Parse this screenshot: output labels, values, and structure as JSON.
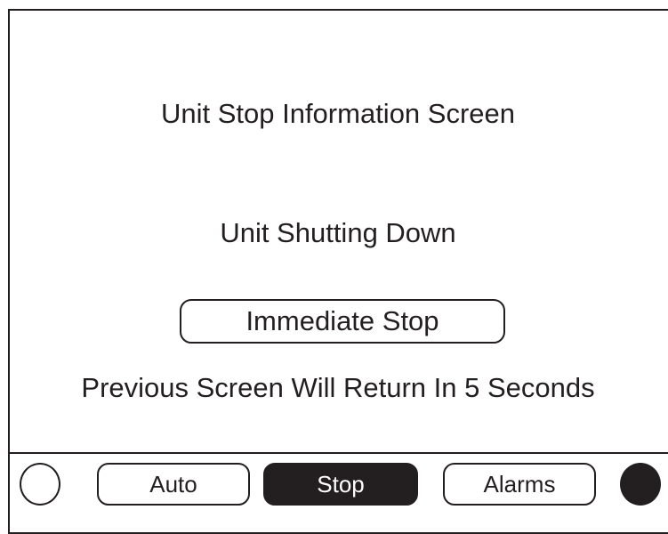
{
  "screen": {
    "title": "Unit Stop Information Screen",
    "status": "Unit Shutting Down",
    "action_button_label": "Immediate Stop",
    "return_message": "Previous Screen Will Return In 5 Seconds"
  },
  "nav": {
    "buttons": [
      {
        "label": "Auto",
        "active": false
      },
      {
        "label": "Stop",
        "active": true
      },
      {
        "label": "Alarms",
        "active": false
      }
    ],
    "left_indicator": {
      "state": "off",
      "color": "#ffffff"
    },
    "right_indicator": {
      "state": "on",
      "color": "#231f20"
    }
  },
  "colors": {
    "foreground": "#231f20",
    "background": "#ffffff"
  }
}
